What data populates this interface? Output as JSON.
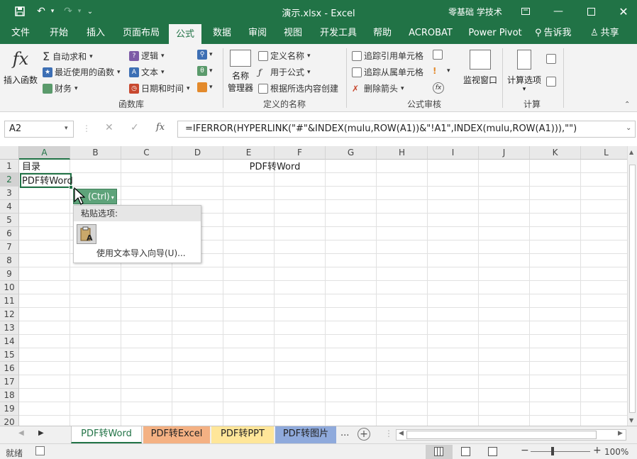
{
  "window": {
    "title": "演示.xlsx  -  Excel",
    "account": "零基础 学技术"
  },
  "tabs": [
    "文件",
    "开始",
    "插入",
    "页面布局",
    "公式",
    "数据",
    "审阅",
    "视图",
    "开发工具",
    "帮助",
    "ACROBAT",
    "Power Pivot",
    "告诉我",
    "共享"
  ],
  "active_tab": "公式",
  "ribbon": {
    "insert_function": {
      "symbol": "fx",
      "label": "插入函数"
    },
    "library": {
      "autosum": "自动求和",
      "recent": "最近使用的函数",
      "financial": "财务",
      "logical": "逻辑",
      "text": "文本",
      "datetime": "日期和时间",
      "group_label": "函数库"
    },
    "names": {
      "name_manager_line1": "名称",
      "name_manager_line2": "管理器",
      "define_name": "定义名称",
      "use_in_formula": "用于公式",
      "create_from_selection": "根据所选内容创建",
      "group_label": "定义的名称"
    },
    "audit": {
      "trace_precedents": "追踪引用单元格",
      "trace_dependents": "追踪从属单元格",
      "remove_arrows": "删除箭头",
      "watch_window": "监视窗口",
      "group_label": "公式审核"
    },
    "calc": {
      "options": "计算选项",
      "group_label": "计算"
    }
  },
  "formula_bar": {
    "name_box": "A2",
    "fx": "fx",
    "formula": "=IFERROR(HYPERLINK(\"#\"&INDEX(mulu,ROW(A1))&\"!A1\",INDEX(mulu,ROW(A1))),\"\")"
  },
  "grid": {
    "columns": [
      "A",
      "B",
      "C",
      "D",
      "E",
      "F",
      "G",
      "H",
      "I",
      "J",
      "K",
      "L"
    ],
    "rows": [
      "1",
      "2",
      "3",
      "4",
      "5",
      "6",
      "7",
      "8",
      "9",
      "10",
      "11",
      "12",
      "13",
      "14",
      "15",
      "16",
      "17",
      "18",
      "19",
      "20"
    ],
    "cells": {
      "A1": "目录",
      "A2": "PDF转Word",
      "E1": "PDF转Word"
    },
    "selected": "A2"
  },
  "paste_options": {
    "button": "(Ctrl)",
    "title": "粘贴选项:",
    "import_wizard": "使用文本导入向导(U)..."
  },
  "sheets": [
    {
      "name": "PDF转Word",
      "color": "#ffffff"
    },
    {
      "name": "PDF转Excel",
      "color": "#f4b183"
    },
    {
      "name": "PDF转PPT",
      "color": "#ffe699"
    },
    {
      "name": "PDF转图片",
      "color": "#8faadc"
    }
  ],
  "sheet_more": "...",
  "status": {
    "ready": "就绪",
    "zoom": "100%"
  }
}
